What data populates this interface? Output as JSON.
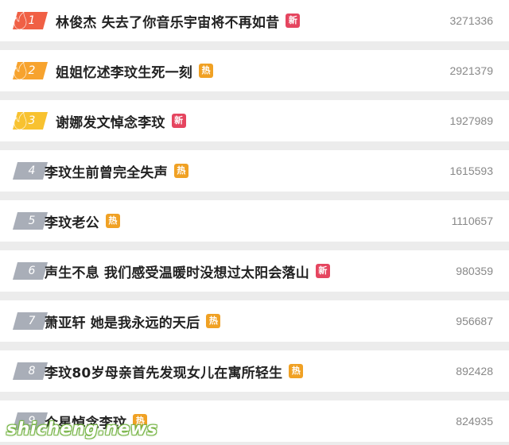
{
  "hot_search": {
    "items": [
      {
        "rank": "1",
        "title": "林俊杰 失去了你音乐宇宙将不再如昔",
        "tag": "新",
        "tag_color": "#e5455f",
        "count": "3271336",
        "badge_color": "#f06045",
        "flame": true
      },
      {
        "rank": "2",
        "title": "姐姐忆述李玟生死一刻",
        "tag": "热",
        "tag_color": "#f0a124",
        "count": "2921379",
        "badge_color": "#f7a32e",
        "flame": true
      },
      {
        "rank": "3",
        "title": "谢娜发文悼念李玟",
        "tag": "新",
        "tag_color": "#e5455f",
        "count": "1927989",
        "badge_color": "#f8c230",
        "flame": true
      },
      {
        "rank": "4",
        "title": "李玟生前曾完全失声",
        "tag": "热",
        "tag_color": "#f0a124",
        "count": "1615593",
        "badge_color": "#a9aeb8",
        "flame": false
      },
      {
        "rank": "5",
        "title": "李玟老公",
        "tag": "热",
        "tag_color": "#f0a124",
        "count": "1110657",
        "badge_color": "#a9aeb8",
        "flame": false
      },
      {
        "rank": "6",
        "title": "声生不息 我们感受温暖时没想过太阳会落山",
        "tag": "新",
        "tag_color": "#e5455f",
        "count": "980359",
        "badge_color": "#a9aeb8",
        "flame": false
      },
      {
        "rank": "7",
        "title": "萧亚轩 她是我永远的天后",
        "tag": "热",
        "tag_color": "#f0a124",
        "count": "956687",
        "badge_color": "#a9aeb8",
        "flame": false
      },
      {
        "rank": "8",
        "title": "李玟80岁母亲首先发现女儿在寓所轻生",
        "tag": "热",
        "tag_color": "#f0a124",
        "count": "892428",
        "badge_color": "#a9aeb8",
        "flame": false
      },
      {
        "rank": "9",
        "title": "众星悼念李玟",
        "tag": "热",
        "tag_color": "#f0a124",
        "count": "824935",
        "badge_color": "#a9aeb8",
        "flame": false
      }
    ]
  },
  "watermark": {
    "text": "shicheng.news"
  }
}
